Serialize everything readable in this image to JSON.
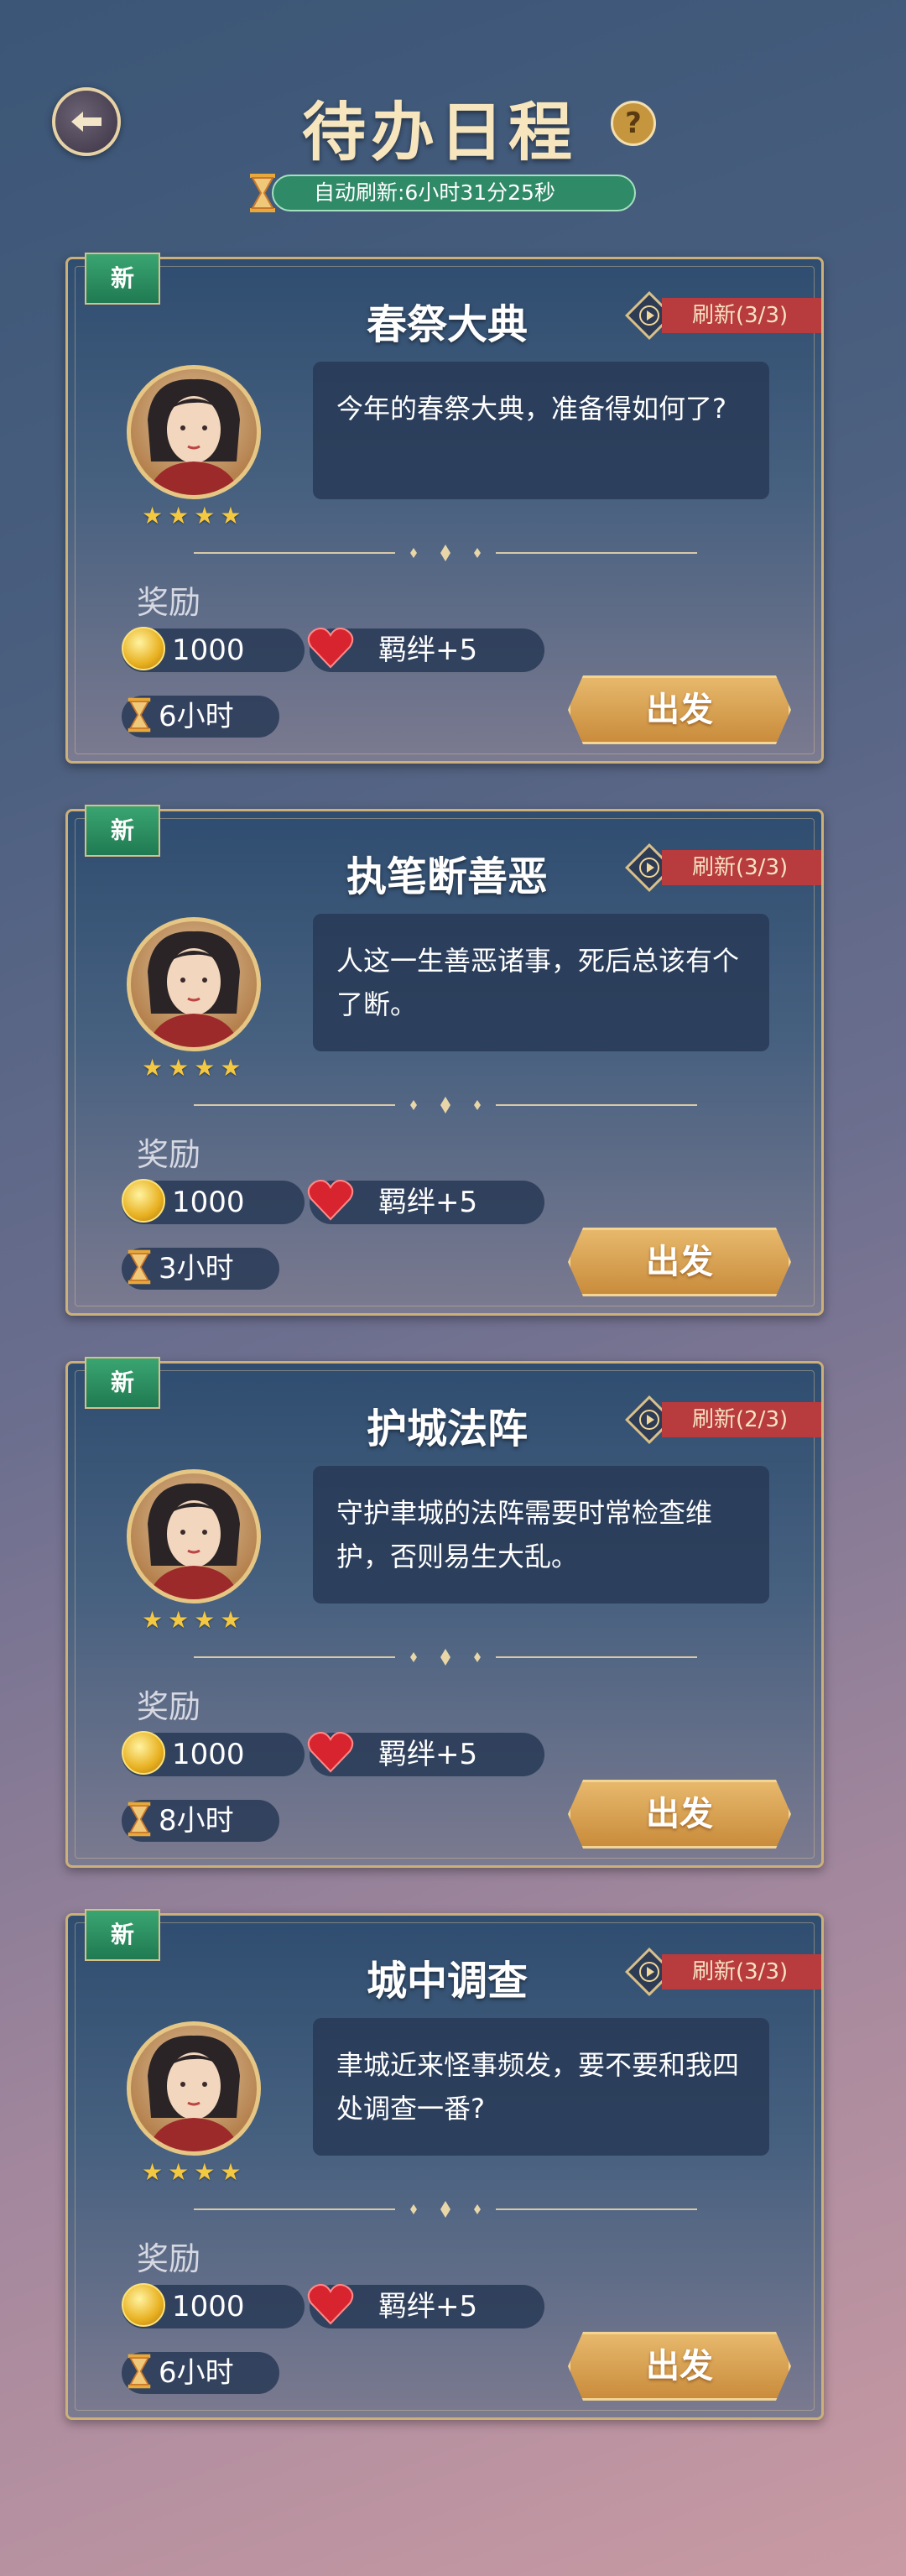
{
  "header": {
    "title": "待办日程",
    "help_icon": "?",
    "auto_refresh": "自动刷新:6小时31分25秒"
  },
  "colors": {
    "refresh_bar": "#2f8a68",
    "refresh_badge": "#b83b3d",
    "go_button": "#d9a054",
    "new_tag": "#2e8f61"
  },
  "cards": [
    {
      "new_tag": "新",
      "title": "春祭大典",
      "refresh": "刷新(3/3)",
      "stars": 4,
      "dialog": "今年的春祭大典，准备得如何了?",
      "reward_label": "奖励",
      "coins": "1000",
      "bond": "羁绊+5",
      "time": "6小时",
      "go": "出发"
    },
    {
      "new_tag": "新",
      "title": "执笔断善恶",
      "refresh": "刷新(3/3)",
      "stars": 4,
      "dialog": "人这一生善恶诸事，死后总该有个了断。",
      "reward_label": "奖励",
      "coins": "1000",
      "bond": "羁绊+5",
      "time": "3小时",
      "go": "出发"
    },
    {
      "new_tag": "新",
      "title": "护城法阵",
      "refresh": "刷新(2/3)",
      "stars": 4,
      "dialog": "守护聿城的法阵需要时常检查维护，否则易生大乱。",
      "reward_label": "奖励",
      "coins": "1000",
      "bond": "羁绊+5",
      "time": "8小时",
      "go": "出发"
    },
    {
      "new_tag": "新",
      "title": "城中调查",
      "refresh": "刷新(3/3)",
      "stars": 4,
      "dialog": "聿城近来怪事频发，要不要和我四处调查一番?",
      "reward_label": "奖励",
      "coins": "1000",
      "bond": "羁绊+5",
      "time": "6小时",
      "go": "出发"
    }
  ]
}
